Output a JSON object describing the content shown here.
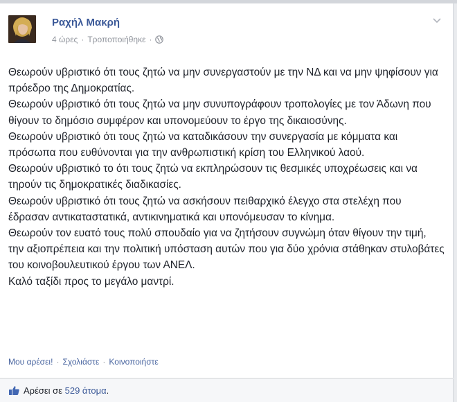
{
  "post": {
    "author": "Ραχήλ Μακρή",
    "time": "4 ώρες",
    "edited": "Τροποποιήθηκε",
    "separator": "·",
    "lines": [
      "Θεωρούν υβριστικό ότι τους ζητώ να μην συνεργαστούν με την ΝΔ και να μην ψηφίσουν για πρόεδρο της Δημοκρατίας.",
      "Θεωρούν υβριστικό ότι τους ζητώ να μην συνυπογράφουν τροπολογίες με τον Άδωνη που θίγουν το δημόσιο συμφέρον και υπονομεύουν το έργο της δικαιοσύνης.",
      "Θεωρούν υβριστικό ότι τους ζητώ να καταδικάσουν την συνεργασία με κόμματα και πρόσωπα που ευθύνονται για την ανθρωπιστική κρίση του Ελληνικού λαού.",
      "Θεωρούν υβριστικό το ότι τους ζητώ να εκπληρώσουν τις θεσμικές υποχρέωσεις και να τηρούν τις δημοκρατικές διαδικασίες.",
      "Θεωρούν υβριστικό ότι τους ζητώ να ασκήσουν πειθαρχικό έλεγχο στα στελέχη που έδρασαν αντικαταστατικά, αντικινηματικά και υπονόμευσαν το κίνημα.",
      "Θεωρούν τον ευατό τους πολύ σπουδαίο για να ζητήσουν συγνώμη όταν θίγουν την τιμή, την αξιοπρέπεια και την πολιτική υπόσταση αυτών που για δύο χρόνια στάθηκαν στυλοβάτες του κοινοβουλευτικού έργου των ΑΝΕΛ.",
      "Καλό ταξίδι προς το μεγάλο μαντρί."
    ]
  },
  "actions": {
    "like": "Μου αρέσει!",
    "comment": "Σχολιάστε",
    "share": "Κοινοποιήστε",
    "separator": "·"
  },
  "likes": {
    "prefix": "Αρέσει σε",
    "count": "529 άτομα",
    "suffix": "."
  },
  "icons": {
    "privacy": "globe-icon",
    "menu": "chevron-down-icon",
    "like": "thumbs-up-icon"
  },
  "colors": {
    "link": "#3b5998",
    "meta": "#90949c",
    "text": "#1d2129"
  }
}
